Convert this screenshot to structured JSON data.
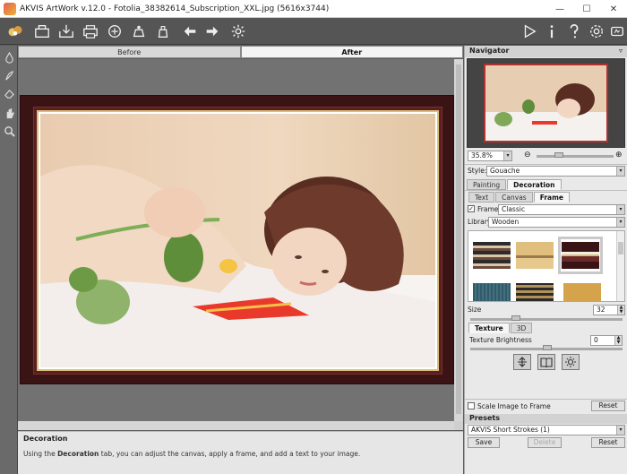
{
  "window": {
    "title": "AKVIS ArtWork v.12.0 - Fotolia_38382614_Subscription_XXL.jpg (5616x3744)",
    "minimize": "—",
    "maximize": "☐",
    "close": "✕"
  },
  "toolbar": {
    "icons": [
      "akvis-logo-icon",
      "open-icon",
      "save-icon",
      "print-icon",
      "share-icon",
      "batch-icon",
      "plugin-icon",
      "undo-icon",
      "redo-icon",
      "settings-gear-icon",
      "run-icon",
      "info-icon",
      "help-icon",
      "preferences-icon",
      "tips-icon"
    ]
  },
  "left_tools": [
    "paint-drop-icon",
    "stroke-brush-icon",
    "eraser-icon",
    "hand-icon",
    "zoom-icon"
  ],
  "view_tabs": {
    "before": "Before",
    "after": "After",
    "active": "After"
  },
  "hint": {
    "title": "Decoration",
    "text_prefix": "Using the ",
    "text_bold": "Decoration",
    "text_suffix": " tab, you can adjust the canvas, apply a frame, and add a text to your image."
  },
  "navigator": {
    "title": "Navigator",
    "zoom": "35.8%"
  },
  "style": {
    "label": "Style:",
    "value": "Gouache"
  },
  "main_tabs": {
    "painting": "Painting",
    "decoration": "Decoration",
    "active": "Decoration"
  },
  "decoration_tabs": {
    "text": "Text",
    "canvas": "Canvas",
    "frame": "Frame",
    "active": "Frame"
  },
  "frame": {
    "enabled_label": "Frame",
    "enabled": true,
    "type": "Classic",
    "library_label": "Library",
    "library": "Wooden",
    "size_label": "Size",
    "size": "32"
  },
  "texture_tabs": {
    "texture": "Texture",
    "three_d": "3D",
    "active": "Texture"
  },
  "texture": {
    "brightness_label": "Texture Brightness",
    "brightness": "0",
    "mode_icons": [
      "flip-vertical-icon",
      "book-mirror-icon",
      "sun-brightness-icon"
    ]
  },
  "scale": {
    "label": "Scale Image to Frame",
    "checked": false
  },
  "reset_label": "Reset",
  "presets": {
    "title": "Presets",
    "value": "AKVIS Short Strokes (1)",
    "save": "Save",
    "delete": "Delete",
    "reset": "Reset"
  },
  "colors": {
    "frame_dark": "#3a1414",
    "frame_gold": "#d8c079",
    "toolbar_bg": "#555555",
    "panel_bg": "#e9e9e9"
  }
}
